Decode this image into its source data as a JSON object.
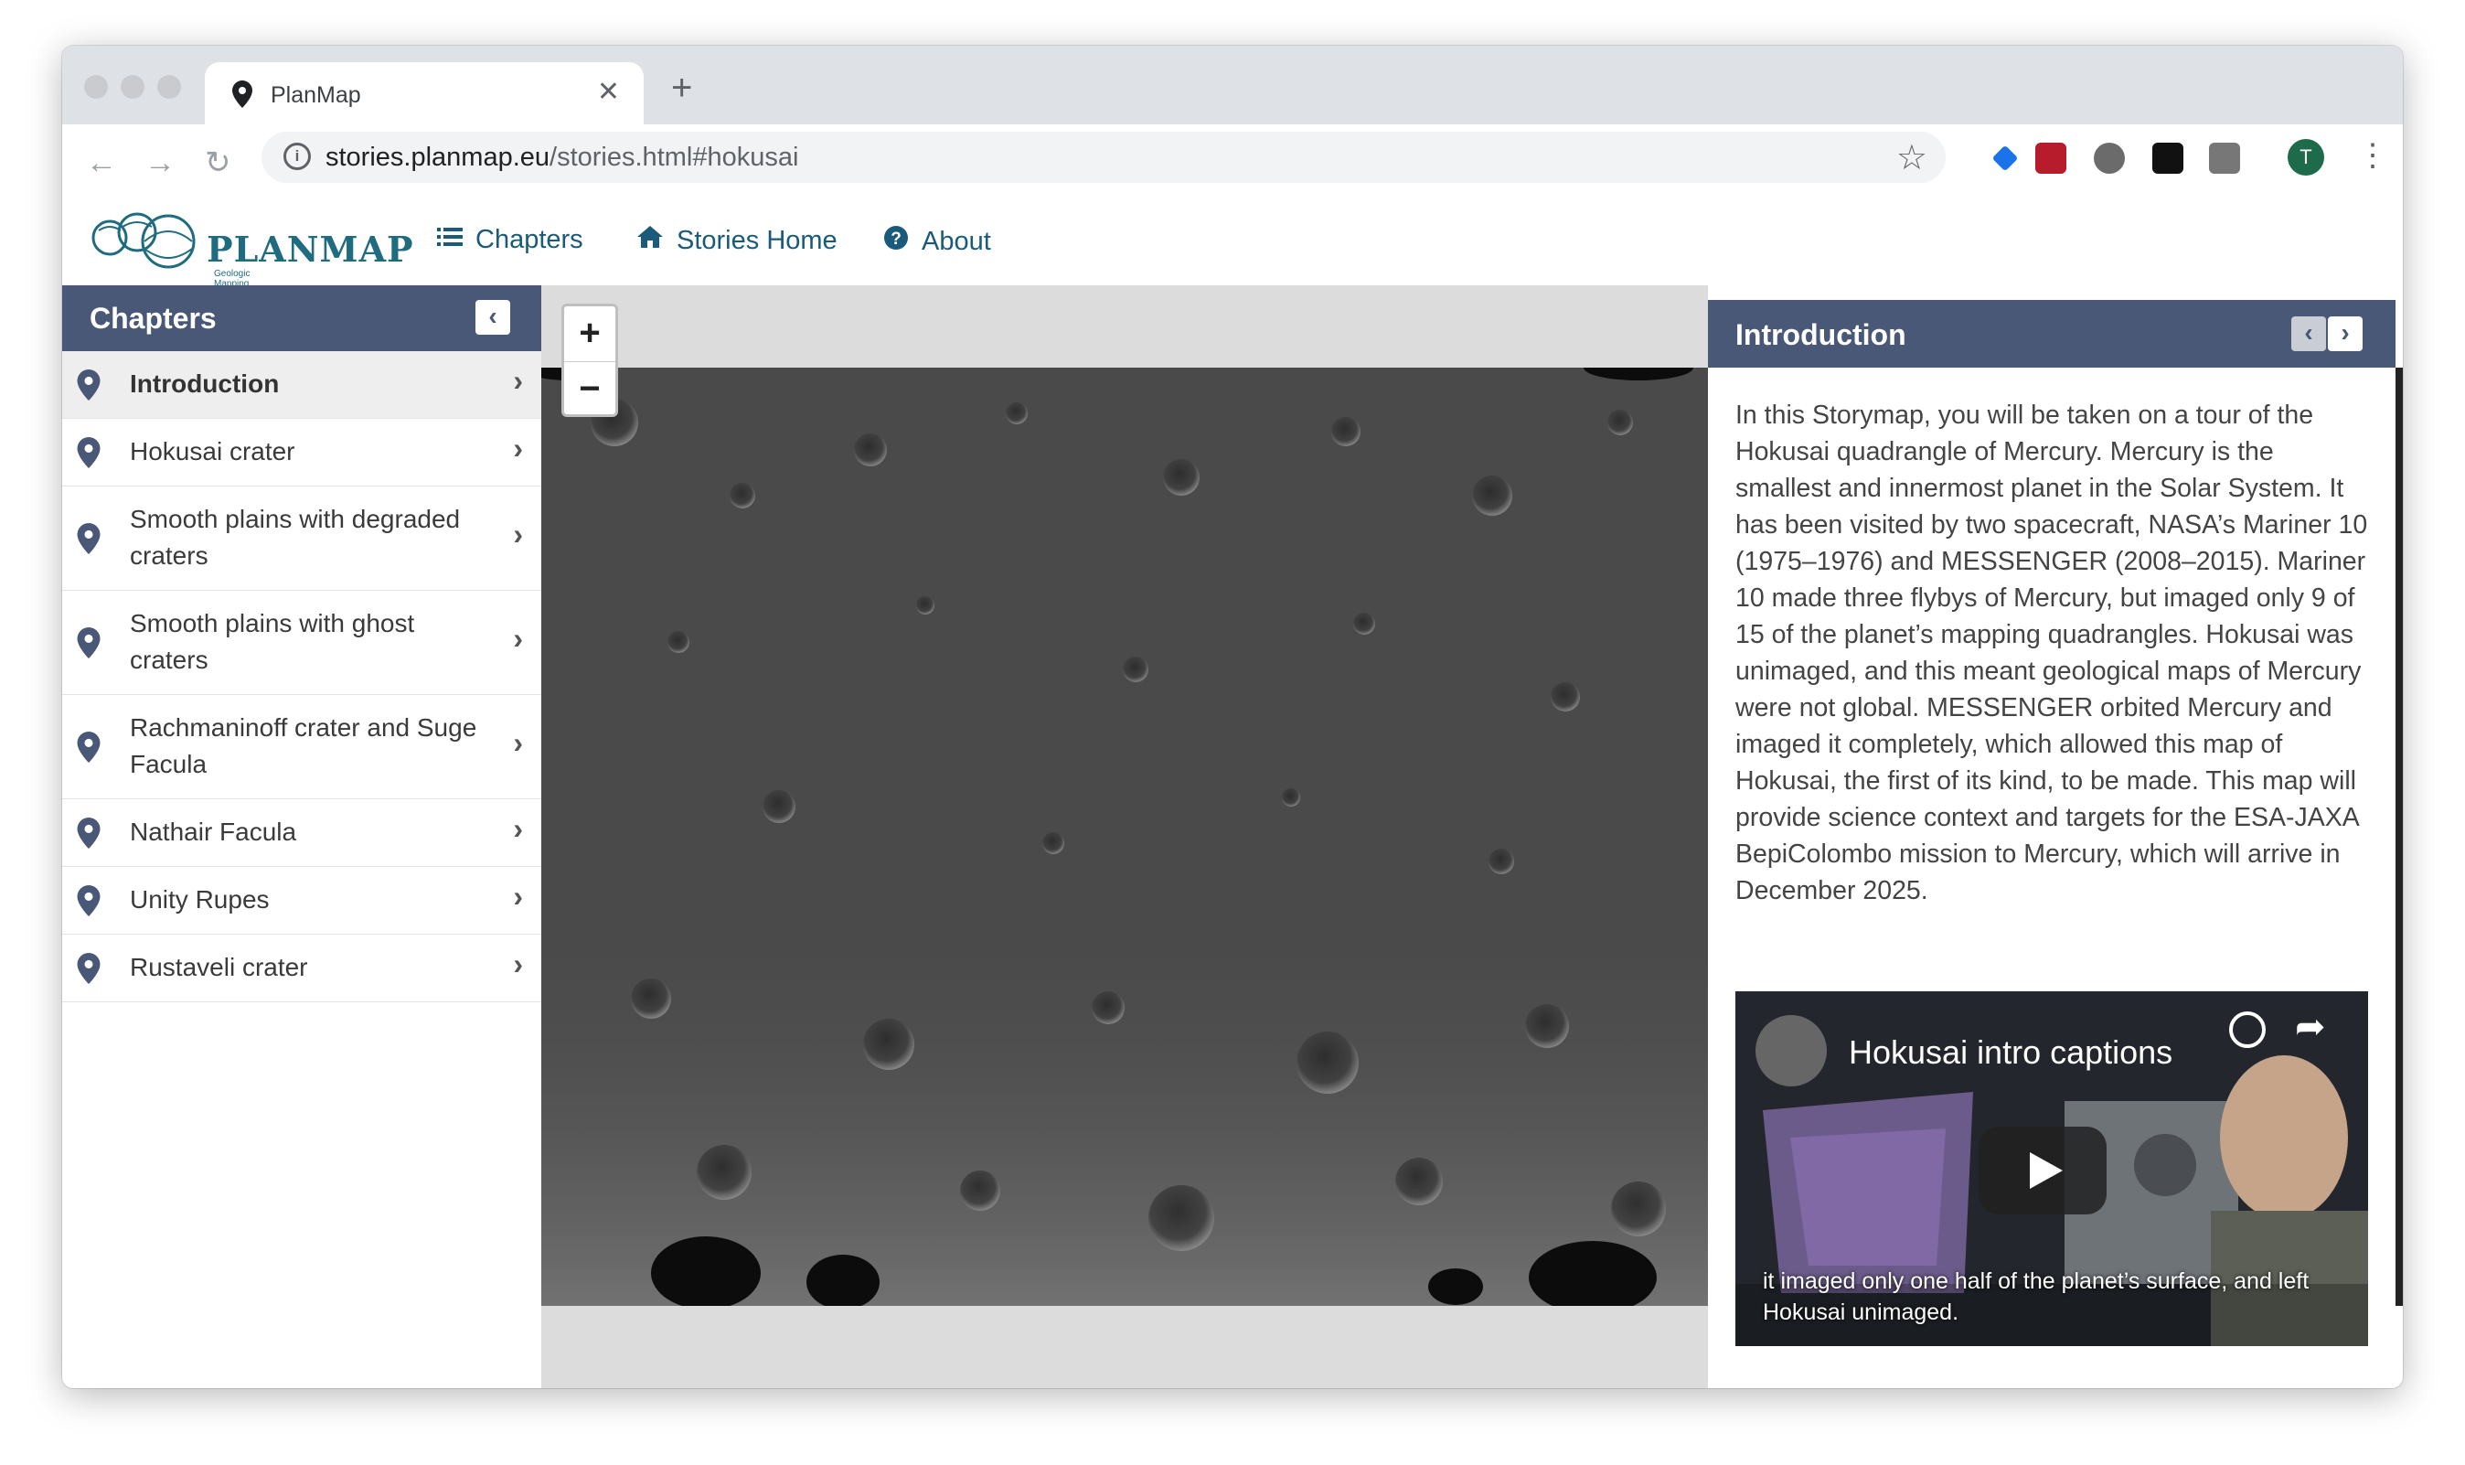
{
  "browser": {
    "tab_title": "PlanMap",
    "url_host": "stories.planmap.eu",
    "url_path": "/stories.html#hokusai",
    "profile_initial": "T"
  },
  "site": {
    "logo_text": "PLANMAP",
    "logo_tagline": "Geologic Mapping of our Solar System",
    "nav": {
      "chapters": "Chapters",
      "stories_home": "Stories Home",
      "about": "About"
    }
  },
  "sidebar": {
    "title": "Chapters",
    "items": [
      {
        "label": "Introduction"
      },
      {
        "label": "Hokusai crater"
      },
      {
        "label": "Smooth plains with degraded craters"
      },
      {
        "label": "Smooth plains with ghost craters"
      },
      {
        "label": "Rachmaninoff crater and Suge Facula"
      },
      {
        "label": "Nathair Facula"
      },
      {
        "label": "Unity Rupes"
      },
      {
        "label": "Rustaveli crater"
      }
    ]
  },
  "map": {
    "zoom_in": "+",
    "zoom_out": "−"
  },
  "panel": {
    "title": "Introduction",
    "body": "In this Storymap, you will be taken on a tour of the Hokusai quadrangle of Mercury. Mercury is the smallest and innermost planet in the Solar System. It has been visited by two spacecraft, NASA’s Mariner 10 (1975–1976) and MESSENGER (2008–2015). Mariner 10 made three flybys of Mercury, but imaged only 9 of 15 of the planet’s mapping quadrangles. Hokusai was unimaged, and this meant geological maps of Mercury were not global. MESSENGER orbited Mercury and imaged it completely, which allowed this map of Hokusai, the first of its kind, to be made. This map will provide science context and targets for the ESA-JAXA BepiColombo mission to Mercury, which will arrive in December 2025.",
    "video_title": "Hokusai intro captions",
    "video_caption": "it imaged only one half of the planet’s surface, and left Hokusai unimaged."
  },
  "colors": {
    "header_bg": "#4a5877",
    "link": "#1a5a7a",
    "logo": "#1f6b80"
  }
}
